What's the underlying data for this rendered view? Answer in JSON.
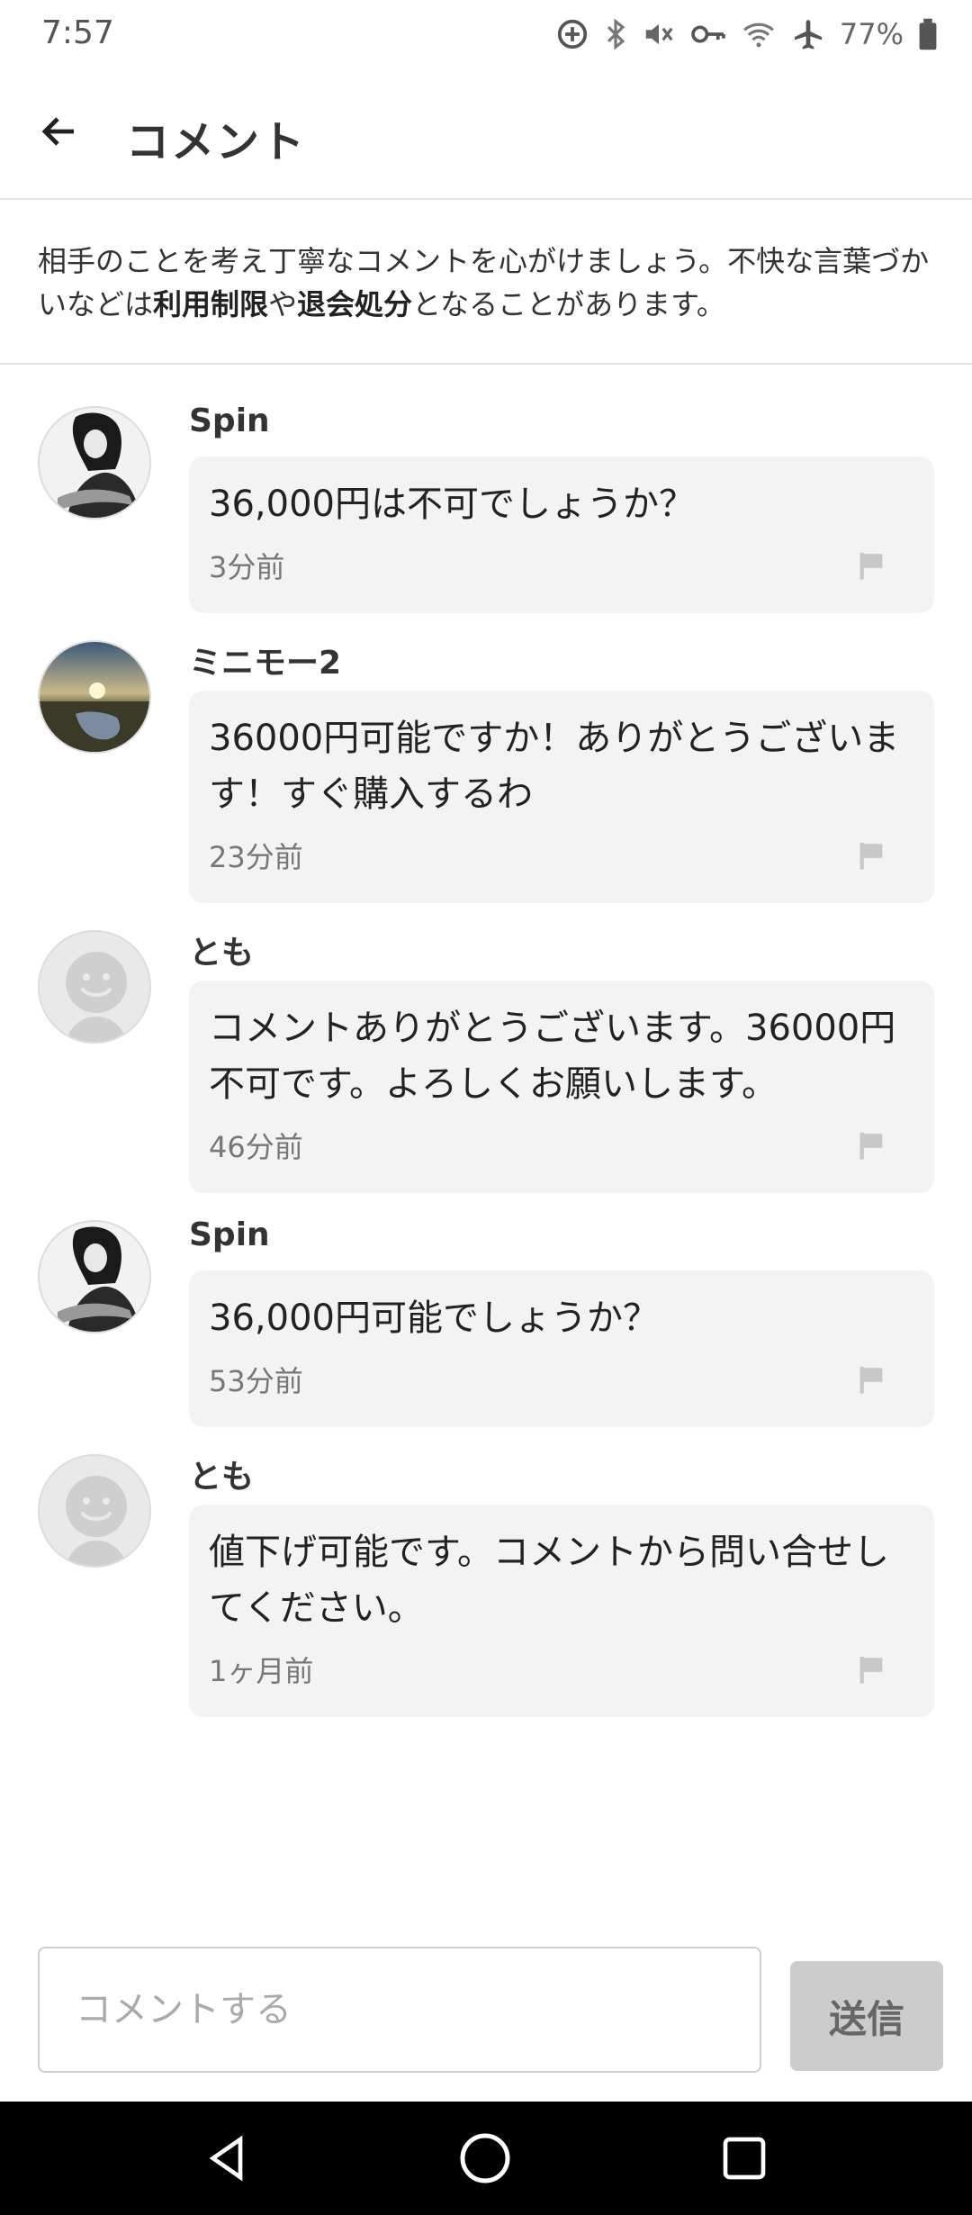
{
  "status_bar": {
    "time": "7:57",
    "battery": "77%",
    "icons": [
      "data-saver-icon",
      "bluetooth-icon",
      "vibrate-mute-icon",
      "vpn-key-icon",
      "wifi-icon",
      "airplane-icon",
      "battery-icon"
    ]
  },
  "header": {
    "title": "コメント",
    "back_icon": "arrow-left-icon"
  },
  "notice": {
    "text_part1": "相手のことを考え丁寧なコメントを心がけましょう。不快な言葉づかいなどは",
    "bold1": "利用制限",
    "text_part2": "や",
    "bold2": "退会処分",
    "text_part3": "となることがあります。"
  },
  "comments": [
    {
      "user": "Spin",
      "avatar": "photo-avatar-person",
      "text": "36,000円は不可でしょうか？",
      "time": "3分前"
    },
    {
      "user": "ミニモー2",
      "avatar": "photo-avatar-sunset",
      "text": "36000円可能ですか！ありがとうございます！すぐ購入するわ",
      "time": "23分前"
    },
    {
      "user": "とも",
      "avatar": "default-avatar",
      "text": "コメントありがとうございます。36000円不可です。よろしくお願いします。",
      "time": "46分前"
    },
    {
      "user": "Spin",
      "avatar": "photo-avatar-person",
      "text": "36,000円可能でしょうか？",
      "time": "53分前"
    },
    {
      "user": "とも",
      "avatar": "default-avatar",
      "text": "値下げ可能です。コメントから問い合せしてください。",
      "time": "1ヶ月前"
    }
  ],
  "input": {
    "placeholder": "コメントする",
    "value": "",
    "send_label": "送信"
  },
  "nav_bar": {
    "icons": [
      "back-triangle-icon",
      "home-circle-icon",
      "recents-square-icon"
    ]
  },
  "colors": {
    "bubble_bg": "#f3f3f3",
    "send_button_bg": "#cccccc",
    "divider": "#e3e3e3",
    "nav_bg": "#000000"
  }
}
